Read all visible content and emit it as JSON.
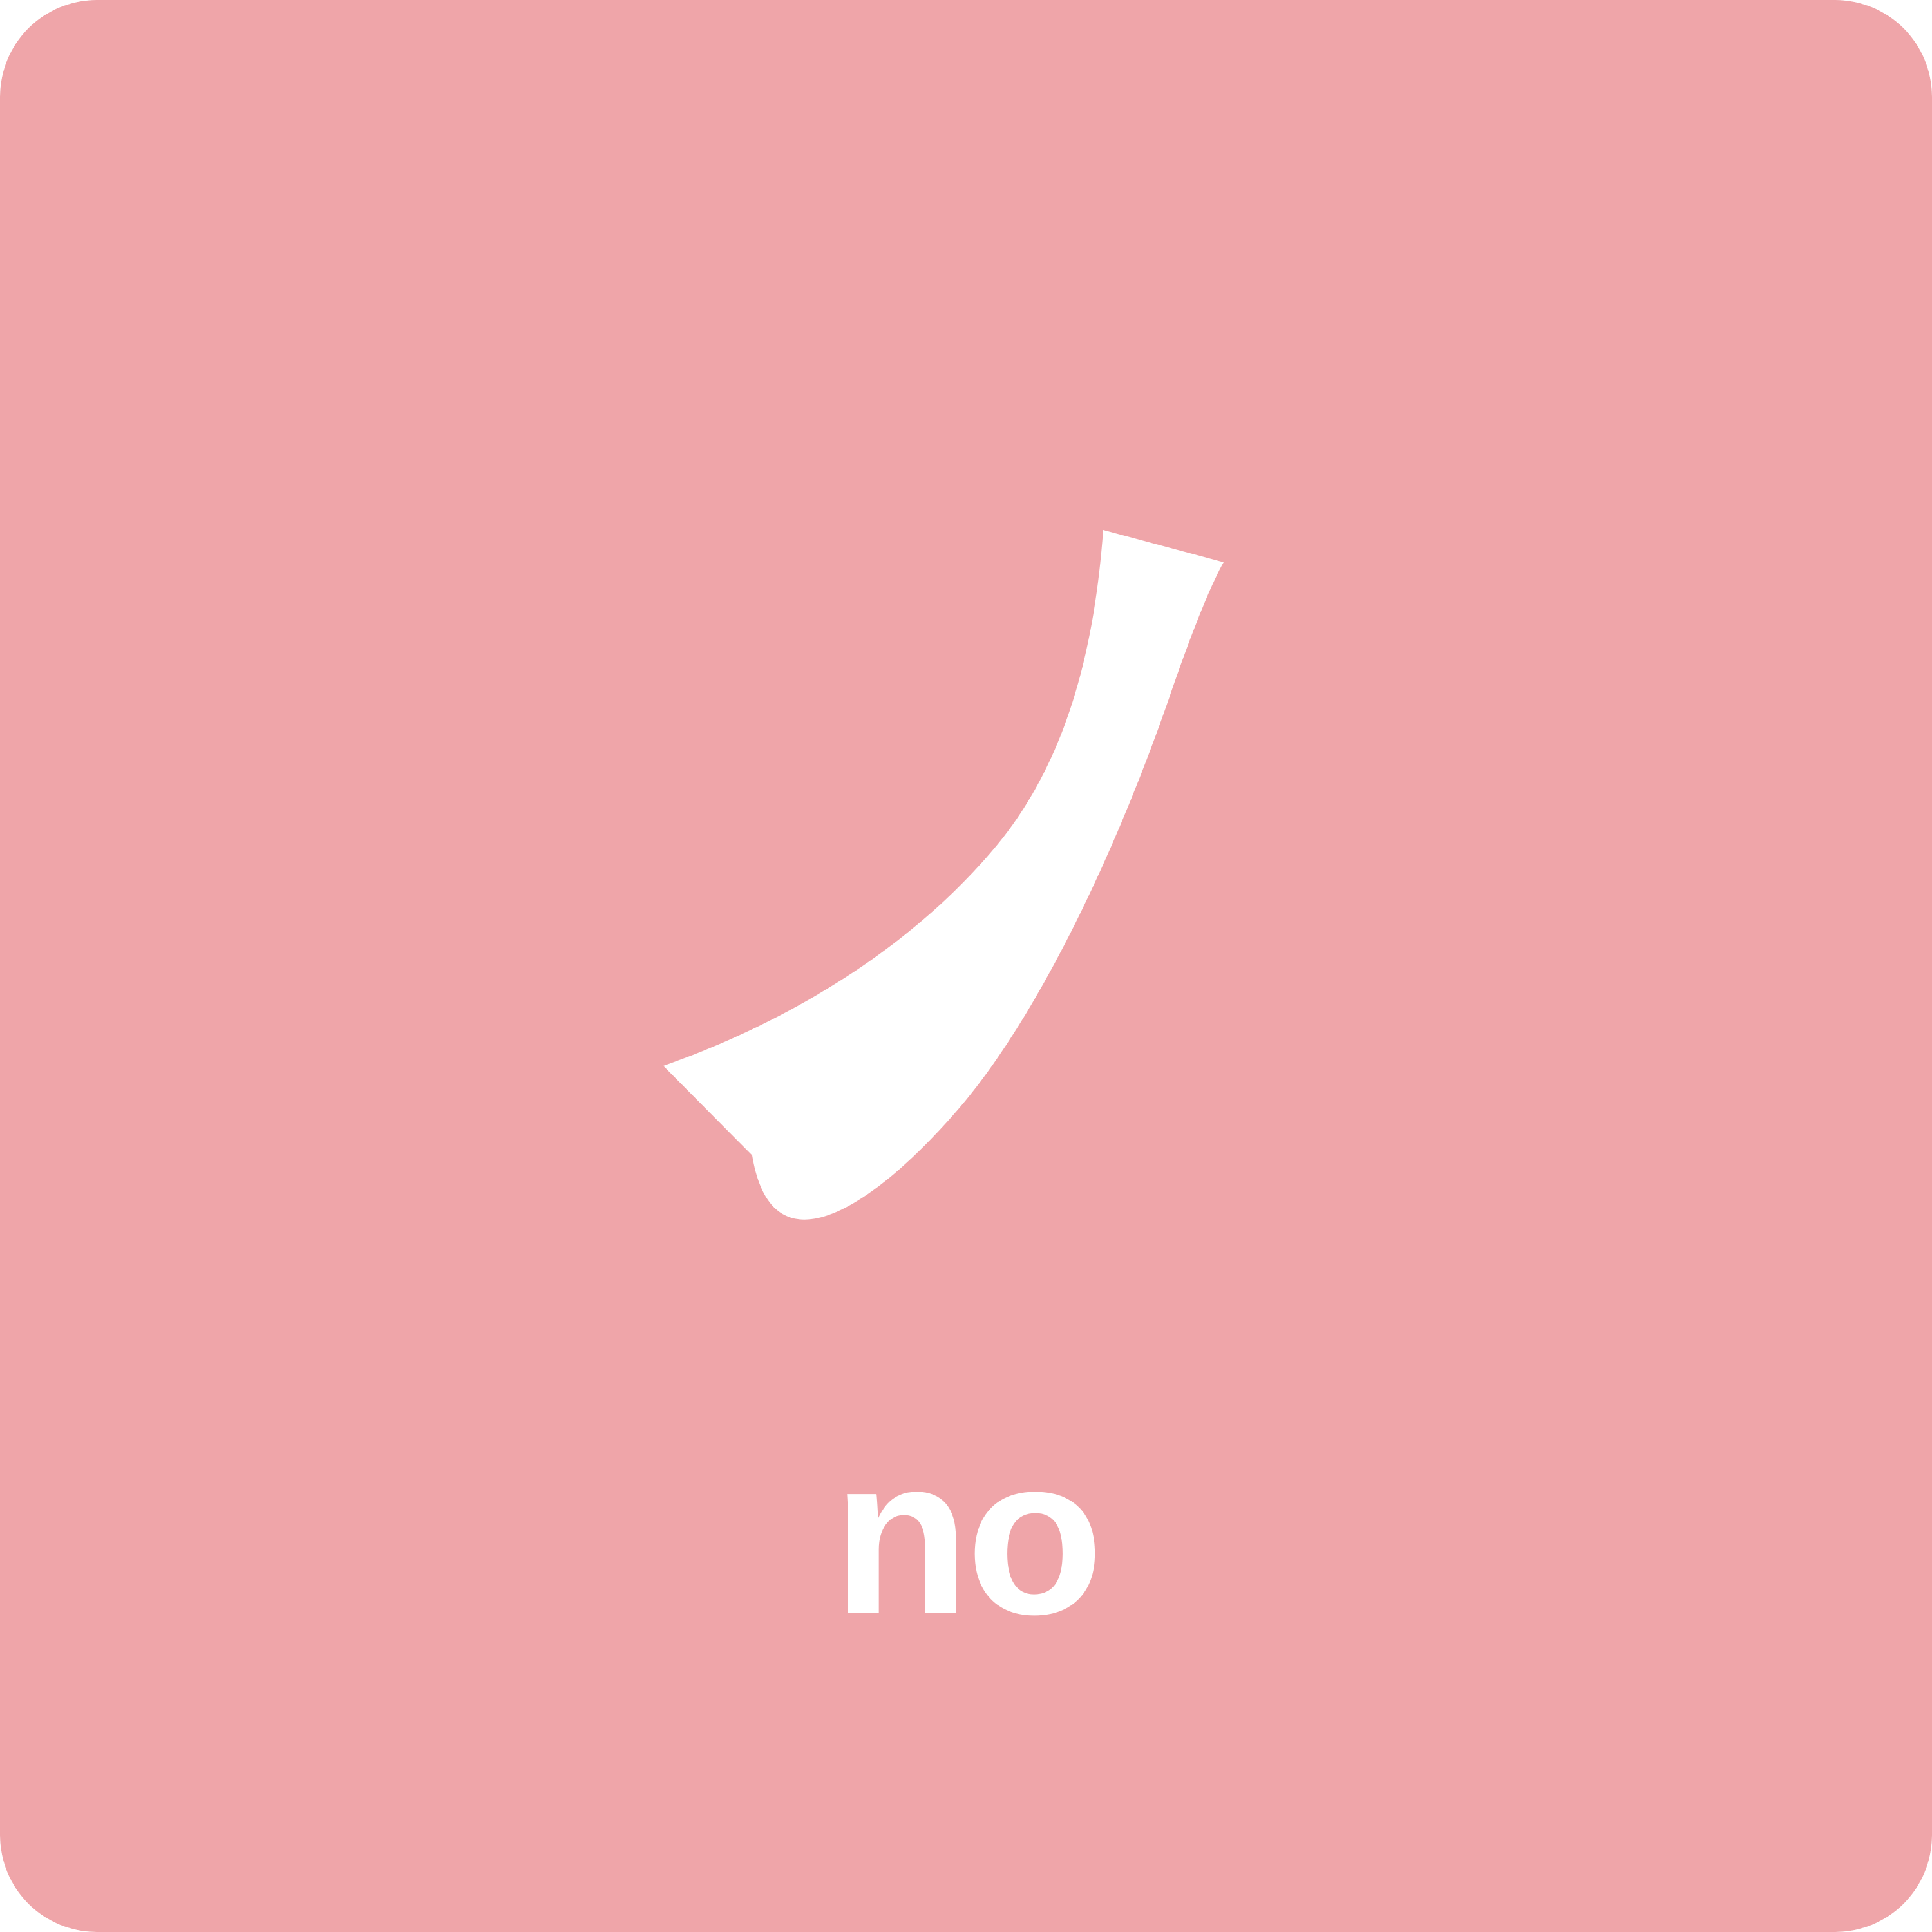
{
  "card": {
    "kana": "ノ",
    "romaji": "no",
    "background_color": "#EFA5A9",
    "text_color": "#FFFFFF"
  }
}
